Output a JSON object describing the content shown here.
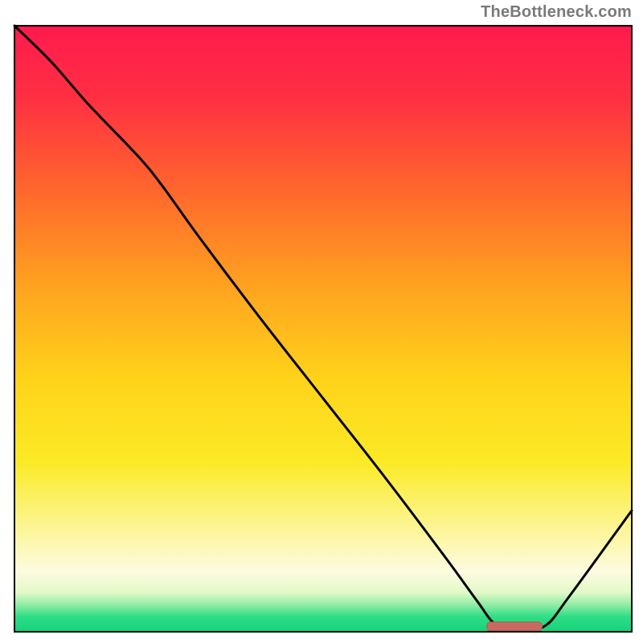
{
  "attribution": "TheBottleneck.com",
  "colors": {
    "curve": "#000000",
    "marker_fill": "#c96a61",
    "marker_stroke": "#b8584f",
    "border": "#000000"
  },
  "chart_data": {
    "type": "line",
    "title": "",
    "xlabel": "",
    "ylabel": "",
    "xlim": [
      0,
      100
    ],
    "ylim": [
      0,
      100
    ],
    "background_gradient": [
      {
        "offset": 0.0,
        "color": "#ff1a4e"
      },
      {
        "offset": 0.12,
        "color": "#ff2f42"
      },
      {
        "offset": 0.28,
        "color": "#ff6a2c"
      },
      {
        "offset": 0.44,
        "color": "#ffa61f"
      },
      {
        "offset": 0.58,
        "color": "#ffd21a"
      },
      {
        "offset": 0.72,
        "color": "#fbea26"
      },
      {
        "offset": 0.84,
        "color": "#fdf6a0"
      },
      {
        "offset": 0.9,
        "color": "#fdfbe0"
      },
      {
        "offset": 0.935,
        "color": "#e3f9c8"
      },
      {
        "offset": 0.955,
        "color": "#93eda6"
      },
      {
        "offset": 0.975,
        "color": "#2fdd86"
      },
      {
        "offset": 1.0,
        "color": "#14d37a"
      }
    ],
    "series": [
      {
        "name": "bottleneck-curve",
        "x": [
          0.0,
          6.0,
          12.0,
          20.0,
          24.0,
          30.0,
          40.0,
          50.0,
          60.0,
          70.0,
          75.0,
          78.0,
          82.0,
          86.0,
          90.0,
          100.0
        ],
        "y": [
          100.0,
          94.0,
          87.0,
          78.5,
          73.5,
          65.0,
          51.5,
          38.5,
          25.5,
          12.0,
          5.0,
          1.2,
          0.6,
          1.0,
          6.0,
          20.0
        ]
      }
    ],
    "marker": {
      "name": "optimal-range",
      "x_start": 76.5,
      "x_end": 85.5,
      "y": 0.9,
      "thickness_pct": 1.4
    }
  }
}
